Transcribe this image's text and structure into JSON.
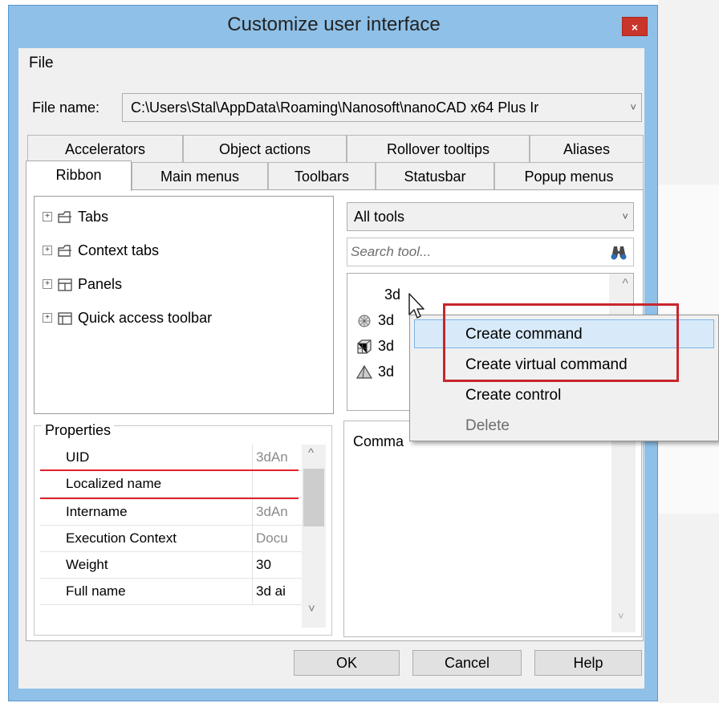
{
  "window": {
    "title": "Customize user interface",
    "close_glyph": "×"
  },
  "menu": {
    "file": "File"
  },
  "file_name": {
    "label": "File name:",
    "value": "C:\\Users\\Stal\\AppData\\Roaming\\Nanosoft\\nanoCAD x64 Plus Ir",
    "chevron": "˅"
  },
  "tabs_row1": [
    "Accelerators",
    "Object actions",
    "Rollover tooltips",
    "Aliases"
  ],
  "tabs_row2": [
    "Ribbon",
    "Main menus",
    "Toolbars",
    "Statusbar",
    "Popup menus"
  ],
  "active_tab": "Ribbon",
  "tree": {
    "items": [
      {
        "label": "Tabs",
        "icon": "tab-folder-icon"
      },
      {
        "label": "Context tabs",
        "icon": "tab-folder-icon"
      },
      {
        "label": "Panels",
        "icon": "panels-icon"
      },
      {
        "label": "Quick access toolbar",
        "icon": "toolbar-icon"
      }
    ],
    "expand_glyph": "+"
  },
  "tool_filter": {
    "value": "All tools",
    "chevron": "˅"
  },
  "search": {
    "placeholder": "Search tool...",
    "icon": "binoculars-icon"
  },
  "tool_list": {
    "items": [
      {
        "label": "3d",
        "icon": ""
      },
      {
        "label": "3d",
        "icon": "mesh-icon"
      },
      {
        "label": "3d",
        "icon": "box-icon"
      },
      {
        "label": "3d",
        "icon": "pyramid-icon"
      }
    ],
    "scroll_up_glyph": "^"
  },
  "properties": {
    "legend": "Properties",
    "rows": [
      {
        "name": "UID",
        "value": "3dAn",
        "gray": true
      },
      {
        "name": "Localized name",
        "value": "",
        "gray": false
      },
      {
        "name": "Intername",
        "value": "3dAn",
        "gray": true
      },
      {
        "name": "Execution Context",
        "value": "Docu",
        "gray": true
      },
      {
        "name": "Weight",
        "value": "30",
        "gray": false
      },
      {
        "name": "Full name",
        "value": "3d ai",
        "gray": false
      }
    ],
    "scroll_up_glyph": "^",
    "scroll_down_glyph": "˅"
  },
  "command": {
    "label": "Comma",
    "scroll_down_glyph": "˅"
  },
  "buttons": {
    "ok": "OK",
    "cancel": "Cancel",
    "help": "Help"
  },
  "context_menu": {
    "items": [
      {
        "label": "Create command",
        "enabled": true,
        "highlighted": true
      },
      {
        "label": "Create virtual command",
        "enabled": true,
        "highlighted": false
      },
      {
        "label": "Create control",
        "enabled": true,
        "highlighted": false
      },
      {
        "label": "Delete",
        "enabled": false,
        "highlighted": false
      }
    ]
  },
  "colors": {
    "title_bar": "#8fc0e7",
    "close_button": "#c9352a",
    "highlight_box": "#c8262d",
    "menu_hover": "#d8eaf9"
  }
}
